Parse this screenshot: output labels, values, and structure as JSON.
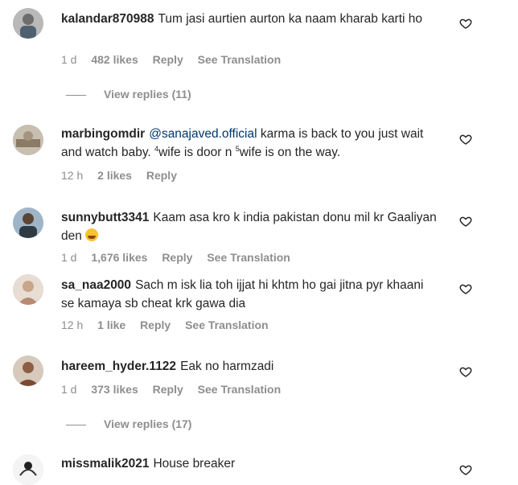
{
  "comments": [
    {
      "username": "kalandar870988",
      "text": "Tum jasi aurtien aurton ka naam kharab karti ho",
      "time": "1 d",
      "likes": "482 likes",
      "reply": "Reply",
      "translation": "See Translation",
      "view_replies": "View replies (11)"
    },
    {
      "username": "marbingomdir",
      "mention": "@sanajaved.official",
      "text_part1": "karma is back to you just wait and watch baby.",
      "sup1": "4",
      "text_part2": "wife is door n",
      "sup2": "5",
      "text_part3": "wife is on the way.",
      "time": "12 h",
      "likes": "2 likes",
      "reply": "Reply"
    },
    {
      "username": "sunnybutt3341",
      "text": "Kaam asa kro k india pakistan donu mil kr Gaaliyan den",
      "time": "1 d",
      "likes": "1,676 likes",
      "reply": "Reply",
      "translation": "See Translation"
    },
    {
      "username": "sa_naa2000",
      "text": "Sach m isk lia toh ijjat hi khtm ho gai jitna pyr khaani se kamaya sb cheat krk gawa dia",
      "time": "12 h",
      "likes": "1 like",
      "reply": "Reply",
      "translation": "See Translation"
    },
    {
      "username": "hareem_hyder.1122",
      "text": "Eak no harmzadi",
      "time": "1 d",
      "likes": "373 likes",
      "reply": "Reply",
      "translation": "See Translation",
      "view_replies": "View replies (17)"
    },
    {
      "username": "missmalik2021",
      "text": "House breaker"
    }
  ],
  "icons": {
    "like": "heart-icon",
    "emoji": "grinning-face-with-sweat-emoji"
  },
  "colors": {
    "text": "#262626",
    "secondary": "#8e8e8e",
    "mention": "#00376b"
  }
}
